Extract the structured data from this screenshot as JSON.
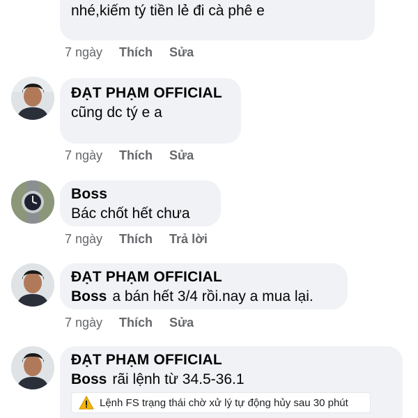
{
  "comments": [
    {
      "author": "",
      "text": "nhé,kiếm tý tiền lẻ đi cà phê e",
      "time": "7 ngày",
      "like": "Thích",
      "second_action": "Sửa"
    },
    {
      "author": "ĐẠT PHẠM OFFICIAL",
      "text": "cũng dc tý e a",
      "time": "7 ngày",
      "like": "Thích",
      "second_action": "Sửa"
    },
    {
      "author": "Boss",
      "text": "Bác chốt hết chưa",
      "time": "7 ngày",
      "like": "Thích",
      "second_action": "Trả lời"
    },
    {
      "author": "ĐẠT PHẠM OFFICIAL",
      "mention": "Boss",
      "text": "a bán hết 3/4 rồi.nay a mua lại.",
      "time": "7 ngày",
      "like": "Thích",
      "second_action": "Sửa"
    },
    {
      "author": "ĐẠT PHẠM OFFICIAL",
      "mention": "Boss",
      "text": "rãi lệnh từ 34.5-36.1",
      "notice": "Lệnh FS trạng thái chờ xử lý tự động hủy sau 30 phút"
    }
  ],
  "colors": {
    "bubble": "#f0f2f5",
    "meta_text": "#65676b",
    "warning": "#f5b400"
  },
  "icons": {
    "avatar_user": "person-avatar-icon",
    "avatar_boss": "watch-avatar-icon",
    "warning": "warning-triangle-icon"
  }
}
